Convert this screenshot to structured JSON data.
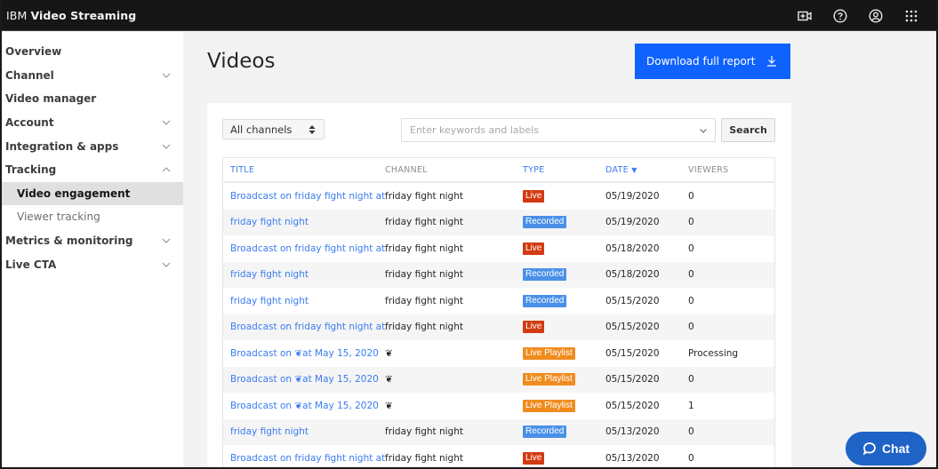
{
  "app": {
    "brand_prefix": "IBM",
    "brand_name": "Video Streaming"
  },
  "topbar": {
    "icons": [
      "add-video-icon",
      "help-icon",
      "user-icon",
      "app-switcher-icon"
    ]
  },
  "sidebar": {
    "items": [
      {
        "label": "Overview",
        "expandable": false
      },
      {
        "label": "Channel",
        "expandable": true
      },
      {
        "label": "Video manager",
        "expandable": false
      },
      {
        "label": "Account",
        "expandable": true
      },
      {
        "label": "Integration & apps",
        "expandable": true
      },
      {
        "label": "Tracking",
        "expandable": true,
        "expanded": true
      },
      {
        "label": "Video engagement",
        "sub": true,
        "active": true
      },
      {
        "label": "Viewer tracking",
        "sub": true
      },
      {
        "label": "Metrics & monitoring",
        "expandable": true
      },
      {
        "label": "Live CTA",
        "expandable": true
      }
    ]
  },
  "main": {
    "title": "Videos",
    "download_label": "Download full report",
    "filters": {
      "channel_selected": "All channels",
      "search_placeholder": "Enter keywords and labels",
      "search_button": "Search"
    },
    "table": {
      "headers": {
        "title": "TITLE",
        "channel": "CHANNEL",
        "type": "TYPE",
        "date": "DATE",
        "viewers": "VIEWERS"
      },
      "sort": {
        "column": "date",
        "direction": "desc",
        "indicator": "▼"
      },
      "rows": [
        {
          "title": "Broadcast on friday fight night at M...",
          "channel": "friday fight night",
          "type": "Live",
          "type_kind": "live",
          "date": "05/19/2020",
          "viewers": "0"
        },
        {
          "title": "friday fight night",
          "channel": "friday fight night",
          "type": "Recorded",
          "type_kind": "recorded",
          "date": "05/19/2020",
          "viewers": "0"
        },
        {
          "title": "Broadcast on friday fight night at M...",
          "channel": "friday fight night",
          "type": "Live",
          "type_kind": "live",
          "date": "05/18/2020",
          "viewers": "0"
        },
        {
          "title": "friday fight night",
          "channel": "friday fight night",
          "type": "Recorded",
          "type_kind": "recorded",
          "date": "05/18/2020",
          "viewers": "0"
        },
        {
          "title": "friday fight night",
          "channel": "friday fight night",
          "type": "Recorded",
          "type_kind": "recorded",
          "date": "05/15/2020",
          "viewers": "0"
        },
        {
          "title": "Broadcast on friday fight night at M...",
          "channel": "friday fight night",
          "type": "Live",
          "type_kind": "live",
          "date": "05/15/2020",
          "viewers": "0"
        },
        {
          "title": "Broadcast on ❦at May 15, 2020",
          "channel": "❦",
          "type": "Live Playlist",
          "type_kind": "playlist",
          "date": "05/15/2020",
          "viewers": "Processing"
        },
        {
          "title": "Broadcast on ❦at May 15, 2020",
          "channel": "❦",
          "type": "Live Playlist",
          "type_kind": "playlist",
          "date": "05/15/2020",
          "viewers": "0"
        },
        {
          "title": "Broadcast on ❦at May 15, 2020",
          "channel": "❦",
          "type": "Live Playlist",
          "type_kind": "playlist",
          "date": "05/15/2020",
          "viewers": "1"
        },
        {
          "title": "friday fight night",
          "channel": "friday fight night",
          "type": "Recorded",
          "type_kind": "recorded",
          "date": "05/13/2020",
          "viewers": "0"
        },
        {
          "title": "Broadcast on friday fight night at M...",
          "channel": "friday fight night",
          "type": "Live",
          "type_kind": "live",
          "date": "05/13/2020",
          "viewers": "0"
        }
      ]
    }
  },
  "chat": {
    "label": "Chat"
  },
  "colors": {
    "primary": "#0f62fe",
    "link": "#3b7cf0",
    "live": "#d23a12",
    "recorded": "#4a90e8",
    "playlist": "#f08c1f",
    "chat": "#1f63c6"
  }
}
